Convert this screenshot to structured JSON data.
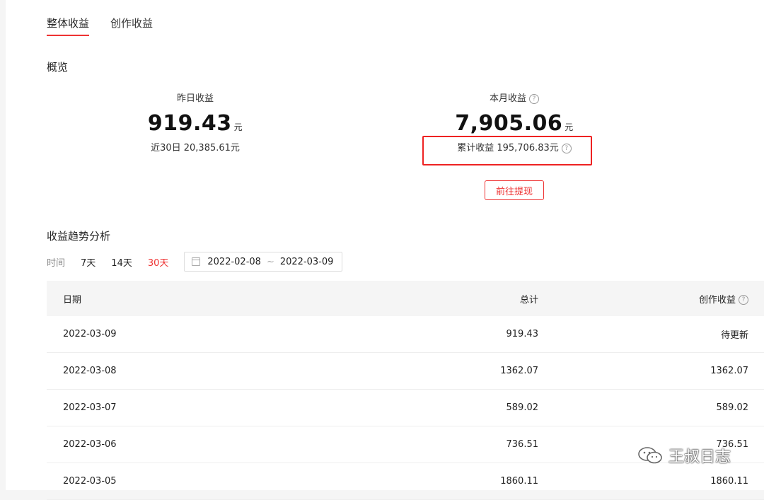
{
  "tabs": [
    {
      "label": "整体收益",
      "active": true
    },
    {
      "label": "创作收益",
      "active": false
    }
  ],
  "overview": {
    "title": "概览",
    "yesterday": {
      "label": "昨日收益",
      "value": "919.43",
      "unit": "元",
      "sub": "近30日 20,385.61元"
    },
    "month": {
      "label": "本月收益",
      "value": "7,905.06",
      "unit": "元",
      "cumulative": "累计收益 195,706.83元",
      "help_icon": "question-circle-icon"
    },
    "withdraw_button": "前往提现"
  },
  "trend": {
    "title": "收益趋势分析",
    "time_label": "时间",
    "ranges": [
      {
        "label": "7天",
        "active": false
      },
      {
        "label": "14天",
        "active": false
      },
      {
        "label": "30天",
        "active": true
      }
    ],
    "date_start": "2022-02-08",
    "date_sep": "~",
    "date_end": "2022-03-09"
  },
  "table": {
    "headers": {
      "date": "日期",
      "total": "总计",
      "creation": "创作收益"
    },
    "rows": [
      {
        "date": "2022-03-09",
        "total": "919.43",
        "creation": "待更新"
      },
      {
        "date": "2022-03-08",
        "total": "1362.07",
        "creation": "1362.07"
      },
      {
        "date": "2022-03-07",
        "total": "589.02",
        "creation": "589.02"
      },
      {
        "date": "2022-03-06",
        "total": "736.51",
        "creation": "736.51"
      },
      {
        "date": "2022-03-05",
        "total": "1860.11",
        "creation": "1860.11"
      }
    ]
  },
  "watermark": {
    "text": "王叔日志",
    "icon": "wechat-icon"
  },
  "colors": {
    "accent": "#e33333",
    "highlight_box": "#e22222"
  }
}
